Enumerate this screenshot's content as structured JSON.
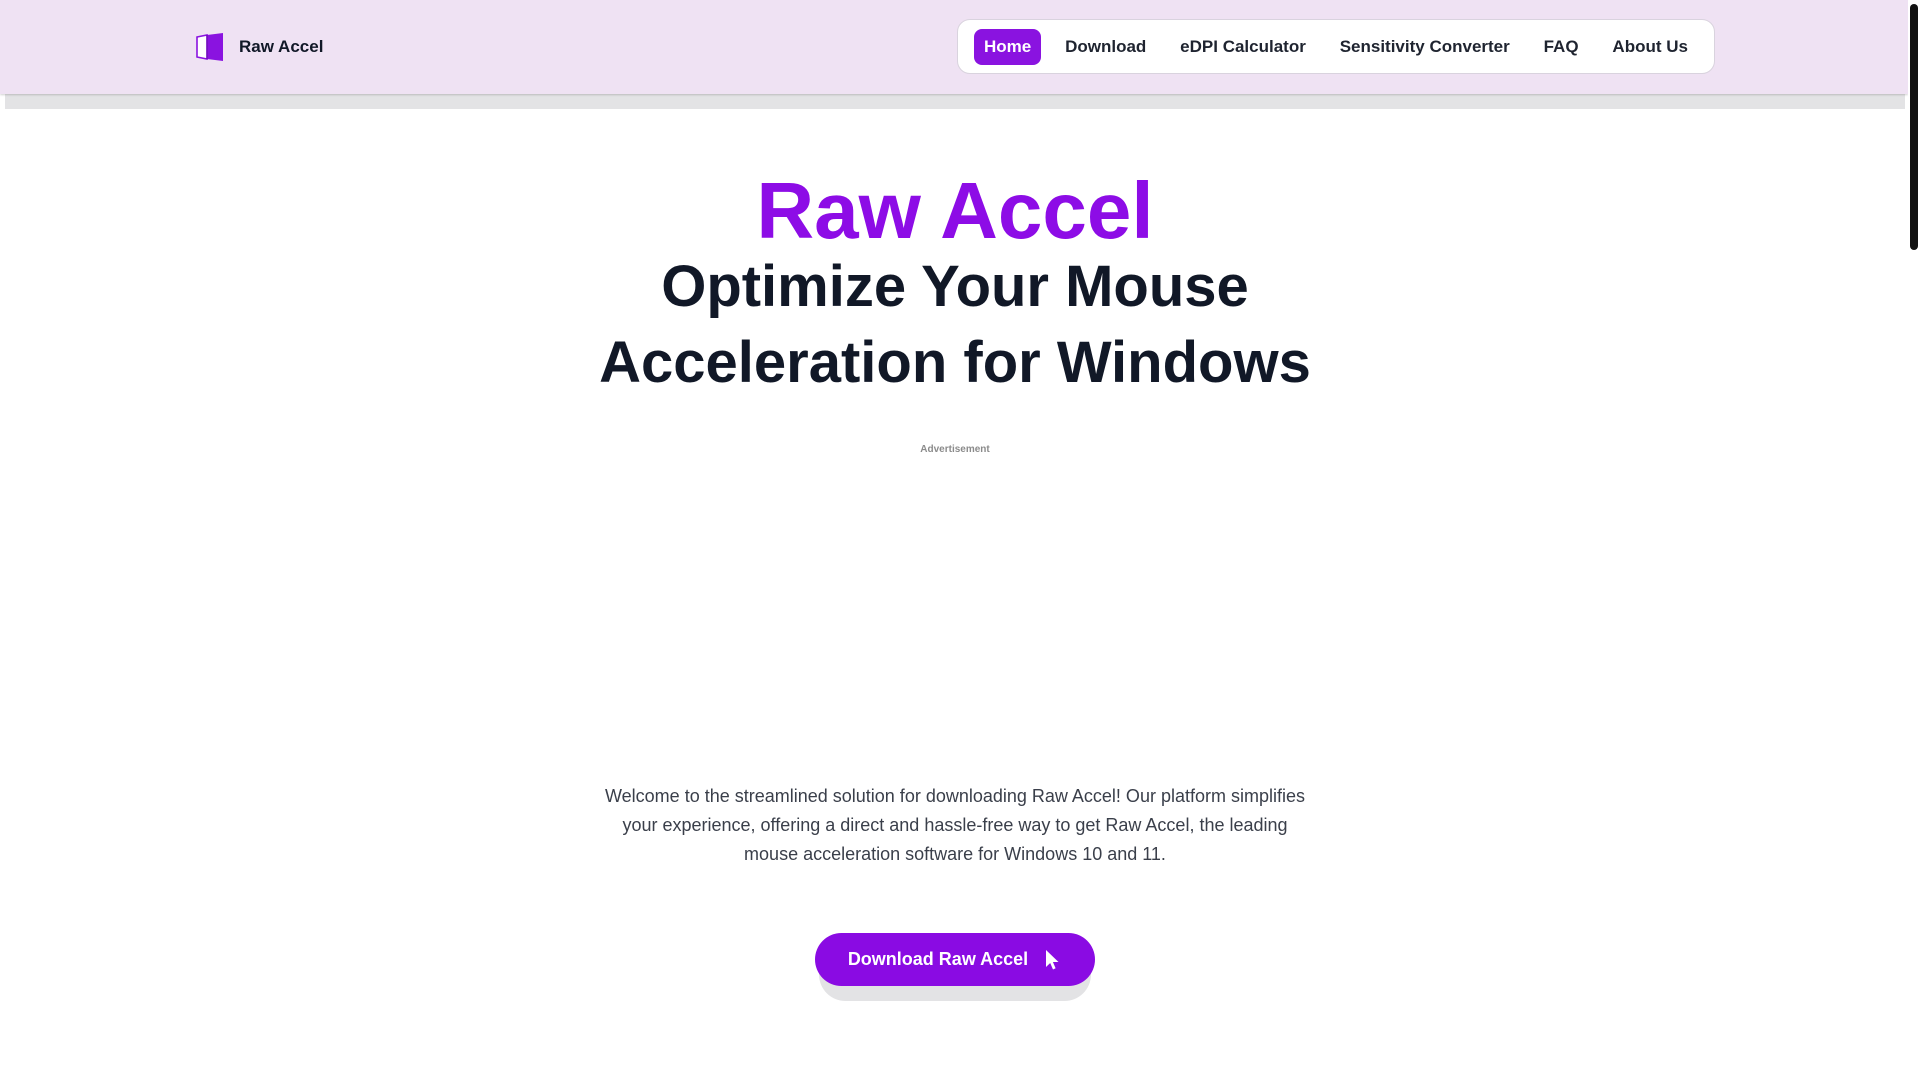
{
  "brand": {
    "name": "Raw Accel"
  },
  "nav": {
    "items": [
      {
        "label": "Home",
        "active": true
      },
      {
        "label": "Download",
        "active": false
      },
      {
        "label": "eDPI Calculator",
        "active": false
      },
      {
        "label": "Sensitivity Converter",
        "active": false
      },
      {
        "label": "FAQ",
        "active": false
      },
      {
        "label": "About Us",
        "active": false
      }
    ]
  },
  "hero": {
    "brand": "Raw Accel",
    "title": "Optimize Your Mouse Acceleration for Windows"
  },
  "ad": {
    "label": "Advertisement"
  },
  "intro": {
    "text": "Welcome to the streamlined solution for downloading Raw Accel! Our platform simplifies your experience, offering a direct and hassle-free way to get Raw Accel, the leading mouse acceleration software for Windows 10 and 11."
  },
  "cta": {
    "label": "Download Raw Accel",
    "icon": "cursor-icon"
  },
  "colors": {
    "accent": "#8a13e0",
    "header_bg": "#efe2f3",
    "text": "#111827"
  }
}
